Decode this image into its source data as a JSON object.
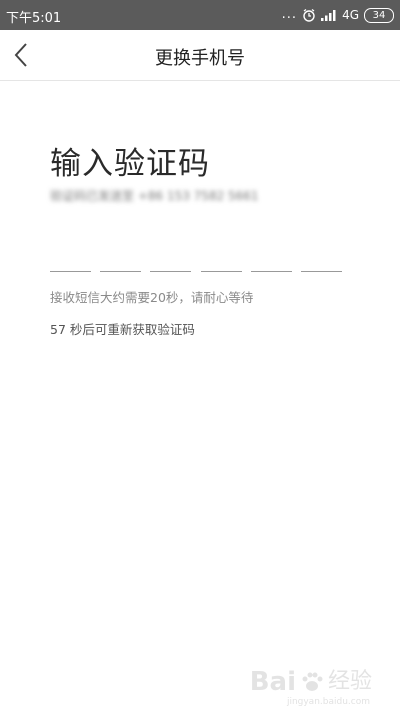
{
  "status_bar": {
    "time": "下午5:01",
    "more": "...",
    "network": "4G",
    "battery": "34",
    "background": "#5b5b5b"
  },
  "header": {
    "title": "更换手机号"
  },
  "main": {
    "heading": "输入验证码",
    "phone_hint": "验证码已发送至 +86 153 7582 5661",
    "code_length": 6,
    "wait_hint": "接收短信大约需要20秒，请耐心等待",
    "resend_text": "57 秒后可重新获取验证码"
  },
  "watermark": {
    "brand": "Bai",
    "text": "经验",
    "url": "jingyan.baidu.com"
  }
}
